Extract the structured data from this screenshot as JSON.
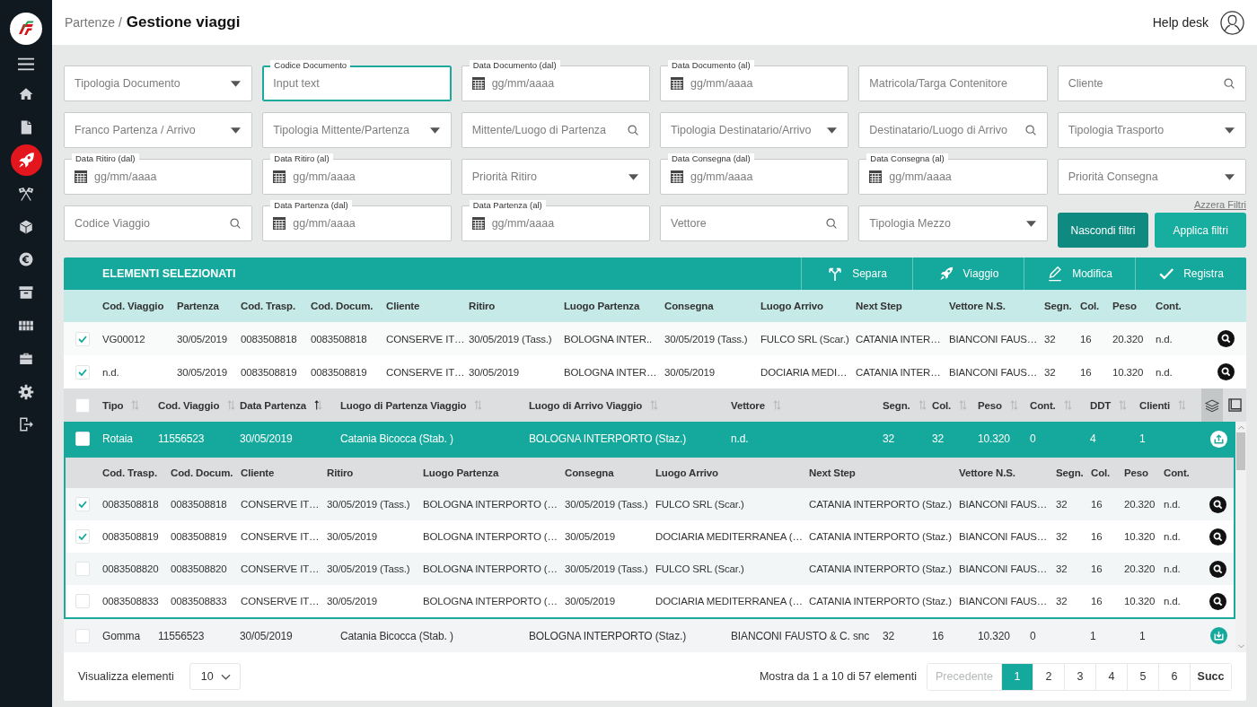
{
  "sidebar": {
    "items": [
      {
        "selected": false
      },
      {
        "selected": false
      },
      {
        "selected": true
      },
      {
        "selected": false
      },
      {
        "selected": false
      },
      {
        "selected": false
      },
      {
        "selected": false
      },
      {
        "selected": false
      },
      {
        "selected": false
      },
      {
        "selected": false
      },
      {
        "selected": false
      }
    ]
  },
  "header": {
    "breadcrumb": "Partenze /",
    "title": "Gestione viaggi",
    "help_link": "Help desk"
  },
  "filters": {
    "fields": [
      {
        "kind": "select",
        "placeholder": "Tipologia Documento",
        "focused": false
      },
      {
        "kind": "text",
        "label": "Codice Documento",
        "placeholder": "Input text",
        "focused": true
      },
      {
        "kind": "date",
        "label": "Data Documento (dal)",
        "placeholder": "gg/mm/aaaa",
        "focused": false
      },
      {
        "kind": "date",
        "label": "Data Documento (al)",
        "placeholder": "gg/mm/aaaa",
        "focused": false
      },
      {
        "kind": "text",
        "placeholder": "Matricola/Targa Contenitore",
        "focused": false
      },
      {
        "kind": "search",
        "placeholder": "Cliente",
        "focused": false
      },
      {
        "kind": "select",
        "placeholder": "Franco Partenza / Arrivo",
        "focused": false
      },
      {
        "kind": "select",
        "placeholder": "Tipologia Mittente/Partenza",
        "focused": false
      },
      {
        "kind": "search",
        "placeholder": "Mittente/Luogo di Partenza",
        "focused": false
      },
      {
        "kind": "select",
        "placeholder": "Tipologia Destinatario/Arrivo",
        "focused": false
      },
      {
        "kind": "search",
        "placeholder": "Destinatario/Luogo di Arrivo",
        "focused": false
      },
      {
        "kind": "select",
        "placeholder": "Tipologia Trasporto",
        "focused": false
      },
      {
        "kind": "date",
        "label": "Data Ritiro (dal)",
        "placeholder": "gg/mm/aaaa",
        "focused": false
      },
      {
        "kind": "date",
        "label": "Data Ritiro (al)",
        "placeholder": "gg/mm/aaaa",
        "focused": false
      },
      {
        "kind": "select",
        "placeholder": "Priorità Ritiro",
        "focused": false
      },
      {
        "kind": "date",
        "label": "Data Consegna (dal)",
        "placeholder": "gg/mm/aaaa",
        "focused": false
      },
      {
        "kind": "date",
        "label": "Data Consegna (al)",
        "placeholder": "gg/mm/aaaa",
        "focused": false
      },
      {
        "kind": "select",
        "placeholder": "Priorità Consegna",
        "focused": false
      },
      {
        "kind": "search",
        "placeholder": "Codice Viaggio",
        "focused": false
      },
      {
        "kind": "date",
        "label": "Data Partenza (dal)",
        "placeholder": "gg/mm/aaaa",
        "focused": false
      },
      {
        "kind": "date",
        "label": "Data Partenza (al)",
        "placeholder": "gg/mm/aaaa",
        "focused": false
      },
      {
        "kind": "search",
        "placeholder": "Vettore",
        "focused": false
      },
      {
        "kind": "select",
        "placeholder": "Tipologia Mezzo",
        "focused": false
      }
    ],
    "reset_link": "Azzera Filtri",
    "buttons": [
      {
        "kind": "secondary",
        "label": "Nascondi filtri"
      },
      {
        "kind": "primary",
        "label": "Applica filtri"
      }
    ]
  },
  "selected_panel": {
    "title": "ELEMENTI SELEZIONATI",
    "actions": [
      {
        "label": "Separa"
      },
      {
        "label": "Viaggio"
      },
      {
        "label": "Modifica"
      },
      {
        "label": "Registra"
      }
    ],
    "columns": [
      "Cod. Viaggio",
      "Partenza",
      "Cod. Trasp.",
      "Cod. Docum.",
      "Cliente",
      "Ritiro",
      "Luogo Partenza",
      "Consegna",
      "Luogo Arrivo",
      "Next Step",
      "Vettore N.S.",
      "Segn.",
      "Col.",
      "Peso",
      "Cont."
    ],
    "rows": [
      {
        "checked": true,
        "cells": [
          "VG00012",
          "30/05/2019",
          "0083508818",
          "0083508818",
          "CONSERVE IT…",
          "30/05/2019 (Tass.)",
          "BOLOGNA INTER..",
          "30/05/2019 (Tass.)",
          "FULCO SRL (Scar.)",
          "CATANIA INTER…",
          "BIANCONI FAUS…",
          "32",
          "16",
          "20.320",
          "n.d."
        ]
      },
      {
        "checked": true,
        "cells": [
          "n.d.",
          "30/05/2019",
          "0083508819",
          "0083508819",
          "CONSERVE IT…",
          "30/05/2019",
          "BOLOGNA INTER…",
          "30/05/2019",
          "DOCIARIA MEDI…",
          "CATANIA INTER…",
          "BIANCONI FAUS…",
          "32",
          "16",
          "10.320",
          "n.d."
        ]
      }
    ]
  },
  "trips_table": {
    "header_checked": false,
    "columns": [
      {
        "label": "Tipo",
        "sorted": false
      },
      {
        "label": "Cod. Viaggio",
        "sorted": false
      },
      {
        "label": "Data Partenza",
        "sorted": true
      },
      {
        "label": "Luogo di Partenza Viaggio",
        "sorted": false
      },
      {
        "label": "Luogo di Arrivo Viaggio",
        "sorted": false
      },
      {
        "label": "Vettore",
        "sorted": false
      },
      {
        "label": "Segn.",
        "sorted": false
      },
      {
        "label": "Col.",
        "sorted": false
      },
      {
        "label": "Peso",
        "sorted": false
      },
      {
        "label": "Cont.",
        "sorted": false
      },
      {
        "label": "DDT",
        "sorted": false
      },
      {
        "label": "Clienti",
        "sorted": false
      }
    ],
    "rows": [
      {
        "checked": false,
        "expanded": true,
        "cells": [
          "Rotaia",
          "11556523",
          "30/05/2019",
          "Catania Bicocca (Stab. )",
          "BOLOGNA INTERPORTO (Staz.)",
          "n.d.",
          "32",
          "32",
          "10.320",
          "0",
          "4",
          "1"
        ],
        "details": {
          "columns": [
            "Cod. Trasp.",
            "Cod. Docum.",
            "Cliente",
            "Ritiro",
            "Luogo Partenza",
            "Consegna",
            "Luogo Arrivo",
            "Next Step",
            "Vettore N.S.",
            "Segn.",
            "Col.",
            "Peso",
            "Cont."
          ],
          "rows": [
            {
              "checked": true,
              "cells": [
                "0083508818",
                "0083508818",
                "CONSERVE IT…",
                "30/05/2019 (Tass.)",
                "BOLOGNA INTERPORTO (…",
                "30/05/2019 (Tass.)",
                "FULCO SRL (Scar.)",
                "CATANIA INTERPORTO (Staz.)",
                "BIANCONI FAUS…",
                "32",
                "16",
                "20.320",
                "n.d."
              ]
            },
            {
              "checked": true,
              "cells": [
                "0083508819",
                "0083508819",
                "CONSERVE IT…",
                "30/05/2019",
                "BOLOGNA INTERPORTO (…",
                "30/05/2019",
                "DOCIARIA MEDITERRANEA (…",
                "CATANIA INTERPORTO (Staz.)",
                "BIANCONI FAUS…",
                "32",
                "16",
                "10.320",
                "n.d."
              ]
            },
            {
              "checked": false,
              "cells": [
                "0083508820",
                "0083508820",
                "CONSERVE IT…",
                "30/05/2019 (Tass.)",
                "BOLOGNA INTERPORTO (…",
                "30/05/2019 (Tass.)",
                "FULCO SRL (Scar.)",
                "CATANIA INTERPORTO (Staz.)",
                "BIANCONI FAUS…",
                "32",
                "16",
                "20.320",
                "n.d."
              ]
            },
            {
              "checked": false,
              "cells": [
                "0083508833",
                "0083508833",
                "CONSERVE IT…",
                "30/05/2019",
                "BOLOGNA INTERPORTO (…",
                "30/05/2019",
                "DOCIARIA MEDITERRANEA (…",
                "CATANIA INTERPORTO (Staz.)",
                "BIANCONI FAUS…",
                "32",
                "16",
                "10.320",
                "n.d."
              ]
            }
          ]
        }
      },
      {
        "checked": false,
        "expanded": false,
        "cells": [
          "Gomma",
          "11556523",
          "30/05/2019",
          "Catania Bicocca (Stab. )",
          "BOLOGNA INTERPORTO (Staz.)",
          "BIANCONI FAUSTO & C. snc",
          "32",
          "16",
          "10.320",
          "0",
          "1",
          "1"
        ]
      }
    ]
  },
  "pagination": {
    "page_size_label": "Visualizza elementi",
    "page_size": "10",
    "summary": "Mostra da 1 a 10 di 57 elementi",
    "prev": {
      "label": "Precedente",
      "disabled": true
    },
    "pages": [
      {
        "label": "1",
        "selected": true
      },
      {
        "label": "2",
        "selected": false
      },
      {
        "label": "3",
        "selected": false
      },
      {
        "label": "4",
        "selected": false
      },
      {
        "label": "5",
        "selected": false
      },
      {
        "label": "6",
        "selected": false
      }
    ],
    "next": {
      "label": "Succ",
      "disabled": false
    }
  }
}
